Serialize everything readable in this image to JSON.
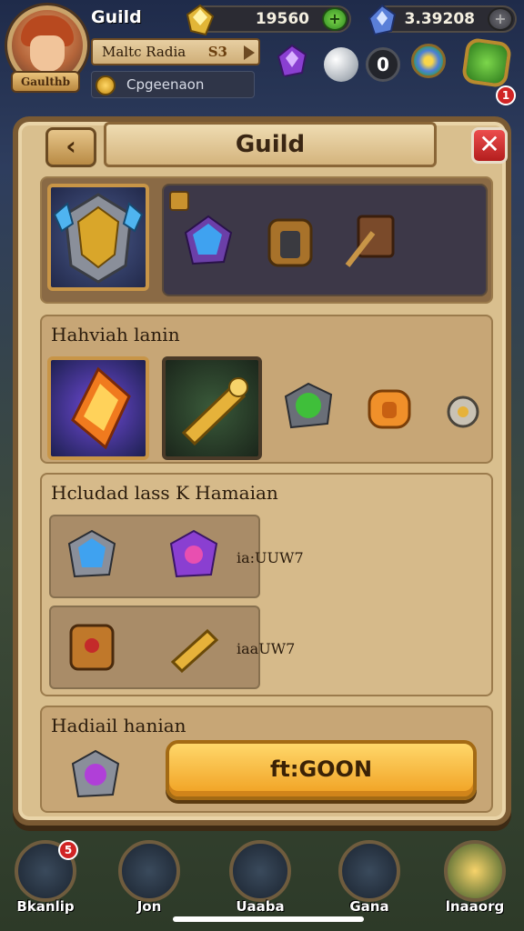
{
  "hud": {
    "title": "Guild",
    "avatar_tag": "Gaulthb",
    "currency1": "19560",
    "currency2": "3.39208",
    "player_name": "Maltc Radia",
    "player_level": "S3",
    "sub_label": "Cpgeenaon",
    "zero_count": "0",
    "notification_count": "1"
  },
  "panel": {
    "title": "Guild",
    "back_icon": "chevron-left-icon",
    "close_label": "✕",
    "section_a_title": "Hahviah lanin",
    "section_b_title": "Hcludad lass K Hamaian",
    "section_b_rows": [
      {
        "value": "ia:UUW7"
      },
      {
        "value": "iaaUW7"
      }
    ],
    "section_c_title": "Hadiail hanian",
    "go_label": "ft:GOON"
  },
  "nav": {
    "items": [
      {
        "label": "Bkanlip",
        "badge": "5"
      },
      {
        "label": "Jon"
      },
      {
        "label": "Uaaba"
      },
      {
        "label": "Gana"
      },
      {
        "label": "lnaaorg"
      }
    ]
  },
  "colors": {
    "panel": "#d9bf8e",
    "frame": "#7a5a33",
    "button_gold": "#f0a021",
    "close_red": "#c62828"
  }
}
